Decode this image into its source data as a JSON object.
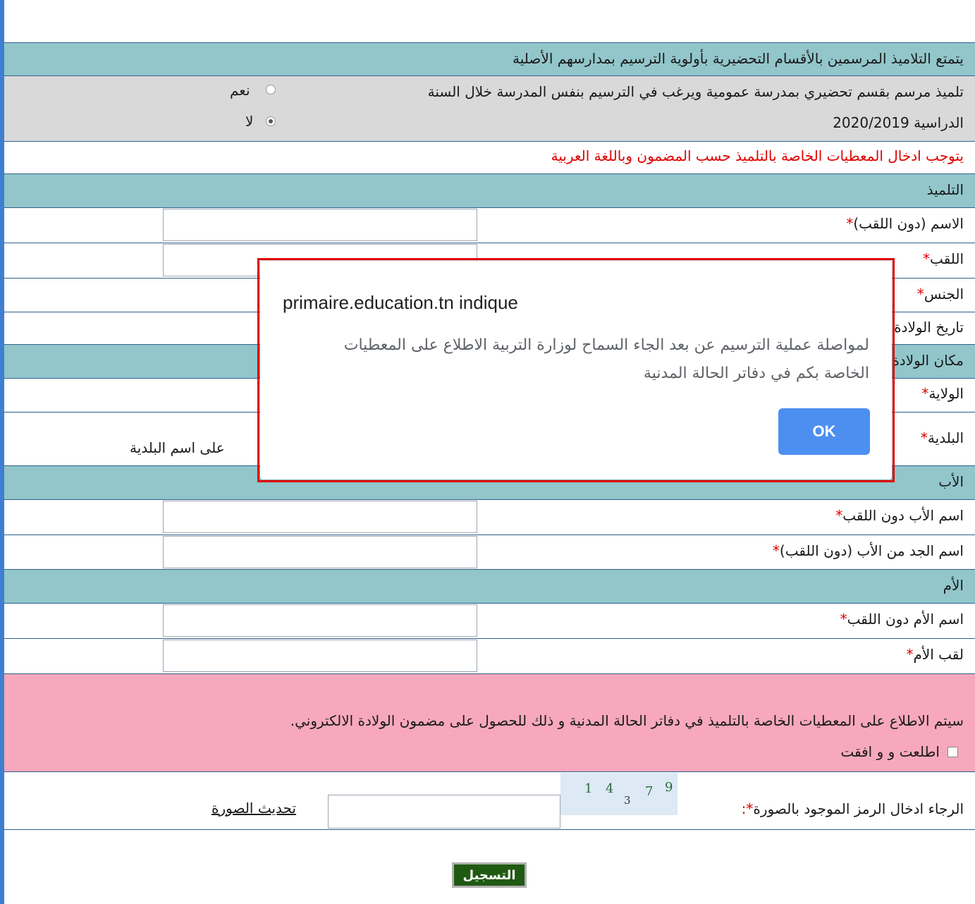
{
  "priority_banner": "يتمتع التلاميذ المرسمين بالأقسام التحضيرية بأولوية الترسيم بمدارسهم الأصلية",
  "question": {
    "text_line1": "تلميذ مرسم بقسم تحضيري بمدرسة عمومية ويرغب في الترسيم بنفس المدرسة خلال السنة",
    "text_line2": "الدراسية 2020/2019",
    "option_yes": "نعم",
    "option_no": "لا",
    "selected": "لا"
  },
  "warning": "يتوجب ادخال المعطيات الخاصة بالتلميذ حسب المضمون وباللغة العربية",
  "sections": {
    "student": "التلميذ",
    "birthplace": "مكان الولادة",
    "father": "الأب",
    "mother": "الأم"
  },
  "fields": {
    "first_name": "الاسم (دون اللقب)",
    "last_name": "اللقب",
    "gender": "الجنس",
    "birth_date": "تاريخ الولادة",
    "governorate": "الولاية",
    "municipality": "البلدية",
    "municipality_hint": "على اسم البلدية",
    "father_name": "اسم الأب دون اللقب",
    "grandfather_name": "اسم الجد من الأب (دون اللقب)",
    "mother_name": "اسم الأم دون اللقب",
    "mother_surname": "لقب الأم",
    "required_mark": "*"
  },
  "consent": {
    "text": "سيتم الاطلاع على المعطيات الخاصة بالتلميذ في دفاتر الحالة المدنية و ذلك للحصول على مضمون الولادة الالكتروني.",
    "checkbox_label": "اطلعت و و افقت"
  },
  "captcha": {
    "label": "الرجاء ادخال الرمز الموجود بالصورة",
    "required_mark": "*:",
    "digits": [
      "1",
      "4",
      "3",
      "7",
      "9"
    ],
    "refresh": "تحديث الصورة"
  },
  "submit_label": "التسجيل",
  "dialog": {
    "title": "primaire.education.tn indique",
    "message": "لمواصلة عملية الترسيم عن بعد الجاء السماح لوزارة التربية الاطلاع على المعطيات الخاصة بكم في دفاتر الحالة المدنية",
    "ok_label": "OK"
  },
  "colors": {
    "section_teal": "#92c6cb",
    "question_gray": "#d9d9d9",
    "consent_pink": "#f7a8bc",
    "warning_red": "#e00000",
    "ok_blue": "#4d8ff0",
    "submit_green": "#1f5a12"
  }
}
